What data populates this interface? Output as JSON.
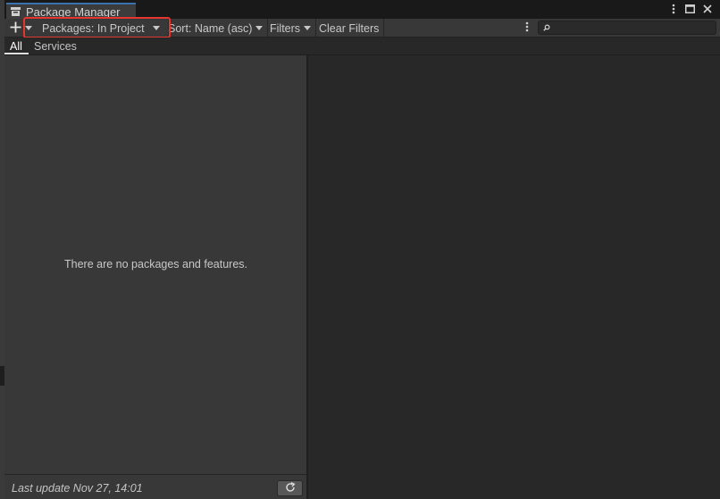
{
  "window": {
    "title": "Package Manager"
  },
  "toolbar": {
    "add_icon": "plus-icon",
    "packages_dropdown": "Packages: In Project",
    "sort_dropdown": "Sort: Name (asc)",
    "filters_dropdown": "Filters",
    "clear_filters": "Clear Filters",
    "search_placeholder": ""
  },
  "tabs": [
    {
      "label": "All",
      "active": true
    },
    {
      "label": "Services",
      "active": false
    }
  ],
  "list": {
    "empty_message": "There are no packages and features."
  },
  "footer": {
    "last_update": "Last update Nov 27, 14:01",
    "refresh_icon": "refresh-icon"
  },
  "colors": {
    "accent_tab": "#3a72b0",
    "highlight": "#e5352f"
  }
}
